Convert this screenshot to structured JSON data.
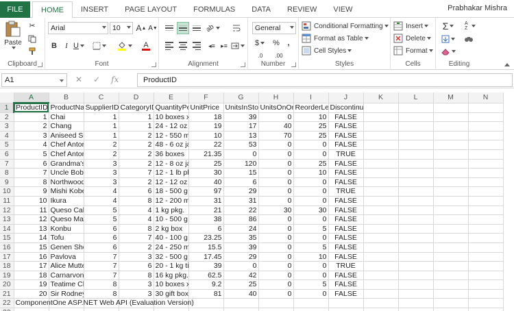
{
  "tabs": {
    "file": "FILE",
    "items": [
      "HOME",
      "INSERT",
      "PAGE LAYOUT",
      "FORMULAS",
      "DATA",
      "REVIEW",
      "VIEW"
    ],
    "active": "HOME",
    "user": "Prabhakar Mishra"
  },
  "ribbon": {
    "clipboard": {
      "paste": "Paste",
      "label": "Clipboard"
    },
    "font": {
      "name": "Arial",
      "size": "10",
      "bold": "B",
      "italic": "I",
      "underline": "U",
      "grow": "A",
      "shrink": "A",
      "font_color": "A",
      "label": "Font"
    },
    "alignment": {
      "label": "Alignment"
    },
    "number": {
      "format": "General",
      "currency": "$",
      "percent": "%",
      "comma": ",",
      "inc_dec": ".0",
      "dec_dec": ".00",
      "label": "Number"
    },
    "styles": {
      "conditional": "Conditional Formatting",
      "table": "Format as Table",
      "cell": "Cell Styles",
      "label": "Styles"
    },
    "cells": {
      "insert": "Insert",
      "delete": "Delete",
      "format": "Format",
      "label": "Cells"
    },
    "editing": {
      "sum": "Σ",
      "sort": "A Z",
      "label": "Editing"
    }
  },
  "formula_bar": {
    "name_box": "A1",
    "content": "ProductID",
    "fx": "fx"
  },
  "sheet": {
    "columns": [
      "A",
      "B",
      "C",
      "D",
      "E",
      "F",
      "G",
      "H",
      "I",
      "J",
      "K",
      "L",
      "M",
      "N"
    ],
    "header": [
      "ProductID",
      "ProductNa",
      "SupplierID",
      "CategoryID",
      "QuantityPe",
      "UnitPrice",
      "UnitsInSto",
      "UnitsOnOr",
      "ReorderLe",
      "Discontinued"
    ],
    "rows": [
      [
        "1",
        "Chai",
        "1",
        "1",
        "10 boxes x",
        "18",
        "39",
        "0",
        "10",
        "FALSE"
      ],
      [
        "2",
        "Chang",
        "1",
        "1",
        "24 - 12 oz",
        "19",
        "17",
        "40",
        "25",
        "FALSE"
      ],
      [
        "3",
        "Aniseed S",
        "1",
        "2",
        "12 - 550 m",
        "10",
        "13",
        "70",
        "25",
        "FALSE"
      ],
      [
        "4",
        "Chef Antor",
        "2",
        "2",
        "48 - 6 oz ja",
        "22",
        "53",
        "0",
        "0",
        "FALSE"
      ],
      [
        "5",
        "Chef Antor",
        "2",
        "2",
        "36 boxes",
        "21.35",
        "0",
        "0",
        "0",
        "TRUE"
      ],
      [
        "6",
        "Grandma's",
        "3",
        "2",
        "12 - 8 oz ja",
        "25",
        "120",
        "0",
        "25",
        "FALSE"
      ],
      [
        "7",
        "Uncle Bob'",
        "3",
        "7",
        "12 - 1 lb pl",
        "30",
        "15",
        "0",
        "10",
        "FALSE"
      ],
      [
        "8",
        "Northwood",
        "3",
        "2",
        "12 - 12 oz",
        "40",
        "6",
        "0",
        "0",
        "FALSE"
      ],
      [
        "9",
        "Mishi Kobe",
        "4",
        "6",
        "18 - 500 g",
        "97",
        "29",
        "0",
        "0",
        "TRUE"
      ],
      [
        "10",
        "Ikura",
        "4",
        "8",
        "12 - 200 m",
        "31",
        "31",
        "0",
        "0",
        "FALSE"
      ],
      [
        "11",
        "Queso Cab",
        "5",
        "4",
        "1 kg pkg.",
        "21",
        "22",
        "30",
        "30",
        "FALSE"
      ],
      [
        "12",
        "Queso Ma",
        "5",
        "4",
        "10 - 500 g",
        "38",
        "86",
        "0",
        "0",
        "FALSE"
      ],
      [
        "13",
        "Konbu",
        "6",
        "8",
        "2 kg box",
        "6",
        "24",
        "0",
        "5",
        "FALSE"
      ],
      [
        "14",
        "Tofu",
        "6",
        "7",
        "40 - 100 g",
        "23.25",
        "35",
        "0",
        "0",
        "FALSE"
      ],
      [
        "15",
        "Genen Sho",
        "6",
        "2",
        "24 - 250 m",
        "15.5",
        "39",
        "0",
        "5",
        "FALSE"
      ],
      [
        "16",
        "Pavlova",
        "7",
        "3",
        "32 - 500 g",
        "17.45",
        "29",
        "0",
        "10",
        "FALSE"
      ],
      [
        "17",
        "Alice Mutte",
        "7",
        "6",
        "20 - 1 kg ti",
        "39",
        "0",
        "0",
        "0",
        "TRUE"
      ],
      [
        "18",
        "Carnarvon",
        "7",
        "8",
        "16 kg pkg.",
        "62.5",
        "42",
        "0",
        "0",
        "FALSE"
      ],
      [
        "19",
        "Teatime Cl",
        "8",
        "3",
        "10 boxes x",
        "9.2",
        "25",
        "0",
        "5",
        "FALSE"
      ],
      [
        "20",
        "Sir Rodney",
        "8",
        "3",
        "30 gift box",
        "81",
        "40",
        "0",
        "0",
        "FALSE"
      ]
    ],
    "footer": "ComponentOne ASP.NET Web API (Evaluation Version)",
    "row_numbers": [
      "1",
      "2",
      "3",
      "4",
      "5",
      "6",
      "7",
      "8",
      "9",
      "10",
      "11",
      "12",
      "13",
      "14",
      "15",
      "16",
      "17",
      "18",
      "19",
      "20",
      "21",
      "22",
      "23"
    ]
  }
}
